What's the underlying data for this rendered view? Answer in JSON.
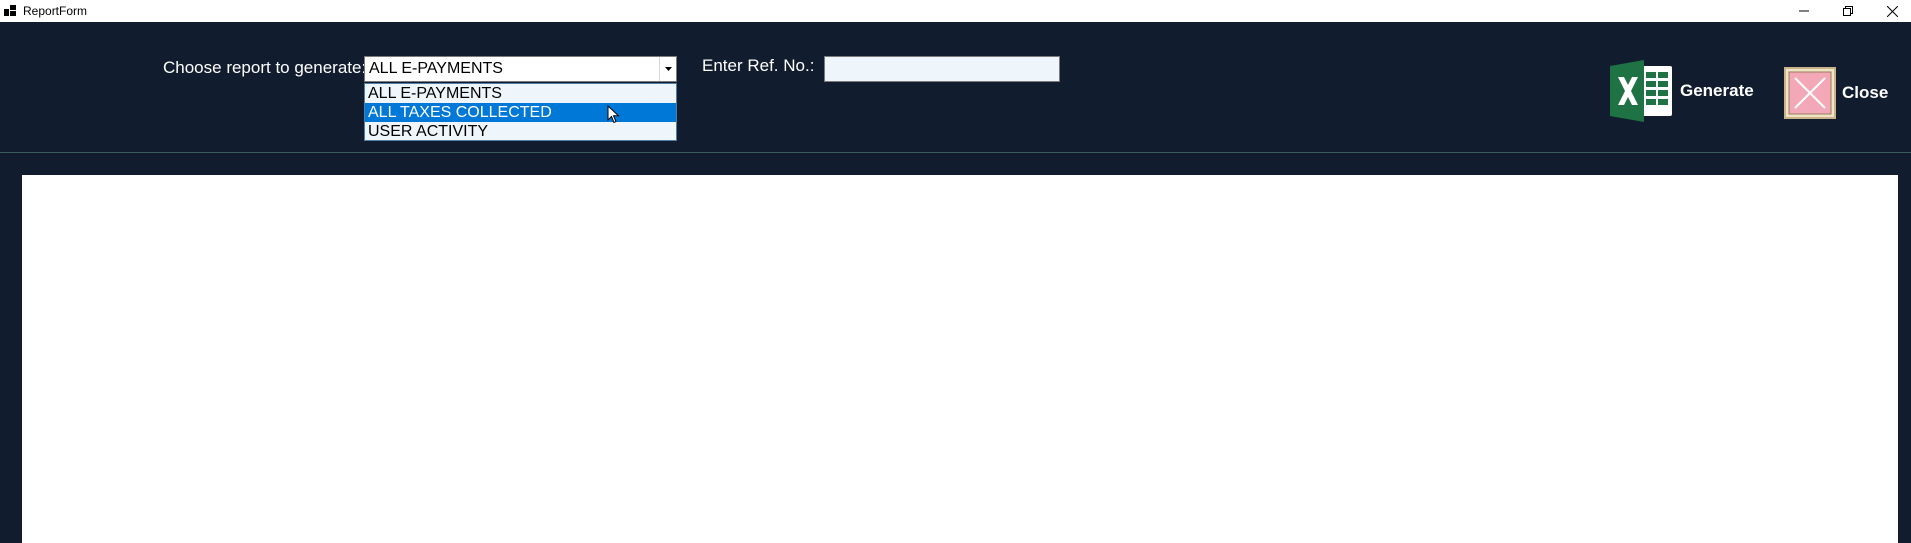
{
  "window": {
    "title": "ReportForm"
  },
  "toolbar": {
    "report_label": "Choose report to generate:",
    "report_selected": "ALL E-PAYMENTS",
    "report_options": [
      "ALL E-PAYMENTS",
      "ALL TAXES COLLECTED",
      "USER ACTIVITY"
    ],
    "highlighted_option_index": 1,
    "ref_label": "Enter Ref. No.:",
    "ref_value": "",
    "generate_label": "Generate",
    "close_label": "Close"
  },
  "colors": {
    "background": "#111d2e",
    "selection": "#0078d7",
    "excel_green": "#1f7244",
    "close_pink": "#f2a8b6"
  }
}
